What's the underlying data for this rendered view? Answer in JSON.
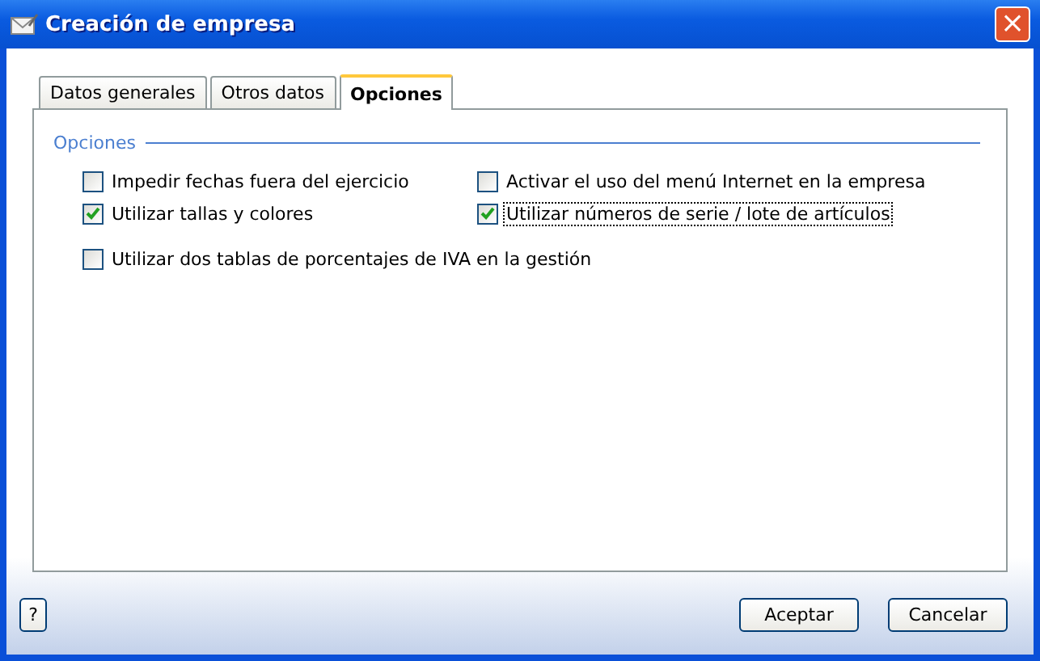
{
  "window": {
    "title": "Creación de empresa",
    "close": "×"
  },
  "tabs": [
    {
      "label": "Datos generales",
      "selected": false
    },
    {
      "label": "Otros datos",
      "selected": false
    },
    {
      "label": "Opciones",
      "selected": true
    }
  ],
  "group": {
    "title": "Opciones"
  },
  "options": [
    {
      "label": "Impedir fechas fuera del ejercicio",
      "checked": false,
      "focused": false
    },
    {
      "label": "Activar el uso del menú Internet en la empresa",
      "checked": false,
      "focused": false
    },
    {
      "label": "Utilizar tallas y colores",
      "checked": true,
      "focused": false
    },
    {
      "label": "Utilizar números de serie / lote de artículos",
      "checked": true,
      "focused": true
    },
    {
      "label": "Utilizar dos tablas de porcentajes de IVA en la gestión",
      "checked": false,
      "focused": false
    }
  ],
  "help_button": "?",
  "buttons": [
    "Aceptar",
    "Cancelar"
  ]
}
